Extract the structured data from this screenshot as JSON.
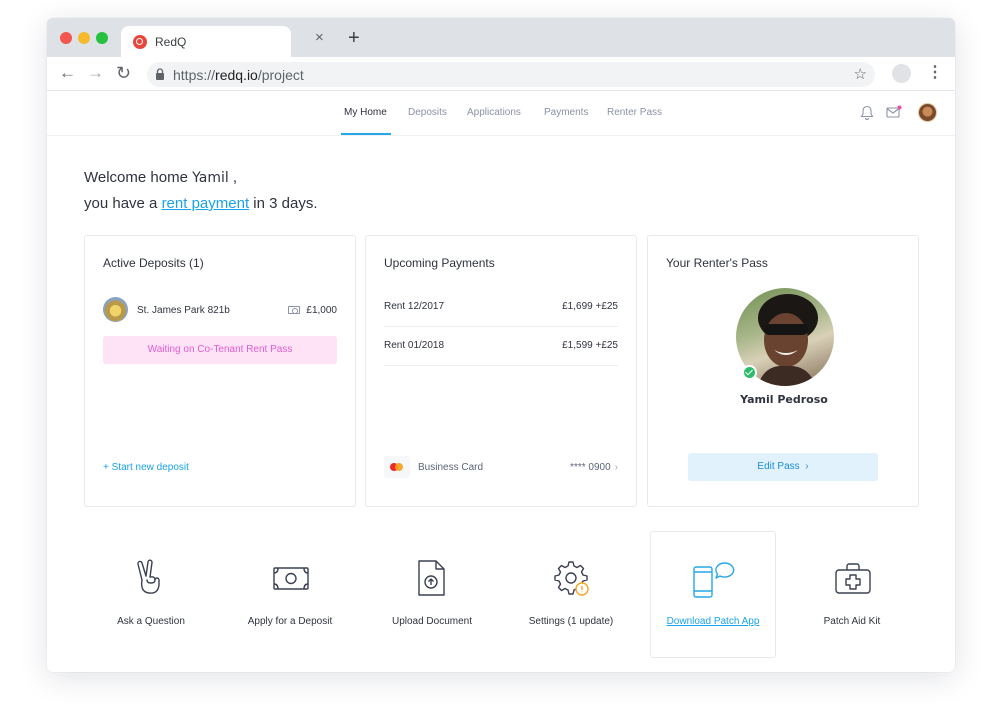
{
  "browser": {
    "tab_title": "RedQ",
    "url_scheme": "https://",
    "url_domain": "redq.io",
    "url_path": "/project"
  },
  "nav": {
    "links": [
      "My Home",
      "Deposits",
      "Applications",
      "Payments",
      "Renter Pass"
    ],
    "active": "My Home",
    "accent": "#25a7e8"
  },
  "welcome": {
    "prefix": "Welcome home",
    "name": "Yamil",
    "suffix": ",",
    "line2_prefix": "you have a",
    "link": "rent payment",
    "line2_suffix": "in 3 days."
  },
  "deposits": {
    "title": "Active Deposits (1)",
    "item_name": "St. James Park 821b",
    "item_amount": "£1,000",
    "status": "Waiting on Co-Tenant Rent Pass",
    "start_link": "+ Start new deposit"
  },
  "payments": {
    "title": "Upcoming Payments",
    "rows": [
      {
        "label": "Rent 12/2017",
        "value": "£1,699  +£25"
      },
      {
        "label": "Rent 01/2018",
        "value": "£1,599 +£25"
      }
    ],
    "card_name": "Business Card",
    "card_number": "**** 0900"
  },
  "pass": {
    "title": "Your Renter's Pass",
    "name": "Yamil Pedroso",
    "edit_button": "Edit Pass"
  },
  "actions": [
    {
      "label": "Ask a Question",
      "icon": "peace-hand-icon"
    },
    {
      "label": "Apply for a Deposit",
      "icon": "banknote-icon"
    },
    {
      "label": "Upload Document",
      "icon": "upload-document-icon"
    },
    {
      "label": "Settings (1 update)",
      "icon": "settings-gear-icon"
    },
    {
      "label": "Download Patch App",
      "icon": "phone-chat-icon"
    },
    {
      "label": "Patch Aid Kit",
      "icon": "aid-kit-icon"
    }
  ]
}
